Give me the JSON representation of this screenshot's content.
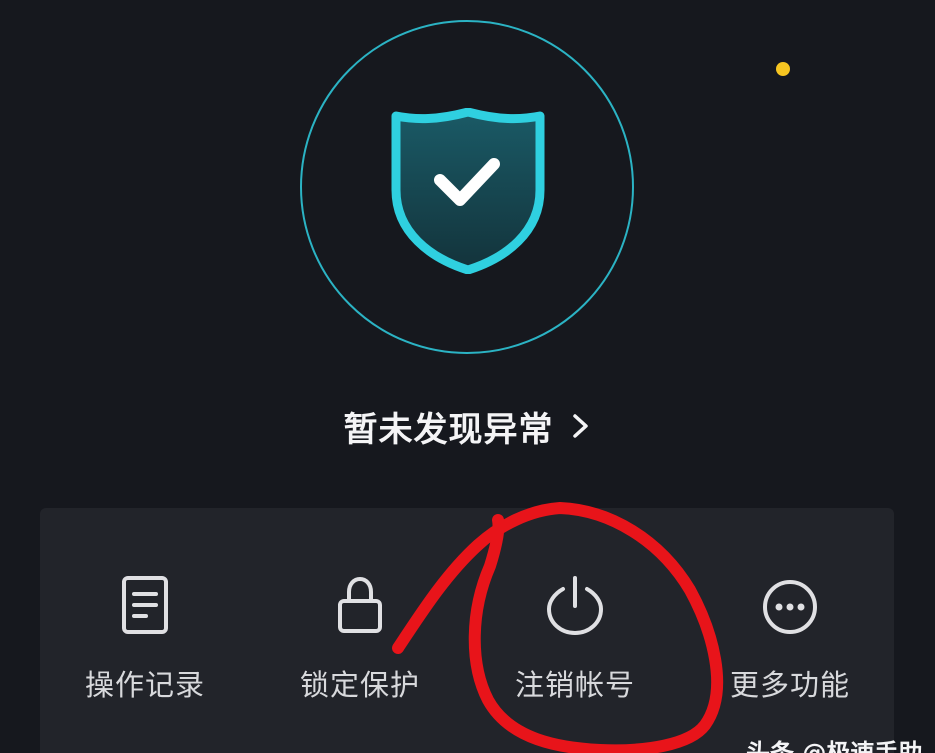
{
  "security": {
    "status_text": "暂未发现异常",
    "accent_color": "#2bb3c4",
    "icon": "shield-check-icon"
  },
  "actions": [
    {
      "label": "操作记录",
      "icon": "document-icon"
    },
    {
      "label": "锁定保护",
      "icon": "lock-icon"
    },
    {
      "label": "注销帐号",
      "icon": "power-icon"
    },
    {
      "label": "更多功能",
      "icon": "more-icon",
      "badge_color": "#f6c521"
    }
  ],
  "annotation": {
    "color": "#e8141a",
    "shape": "freehand-circle"
  },
  "watermark": {
    "text": "头条 @极速手助"
  }
}
